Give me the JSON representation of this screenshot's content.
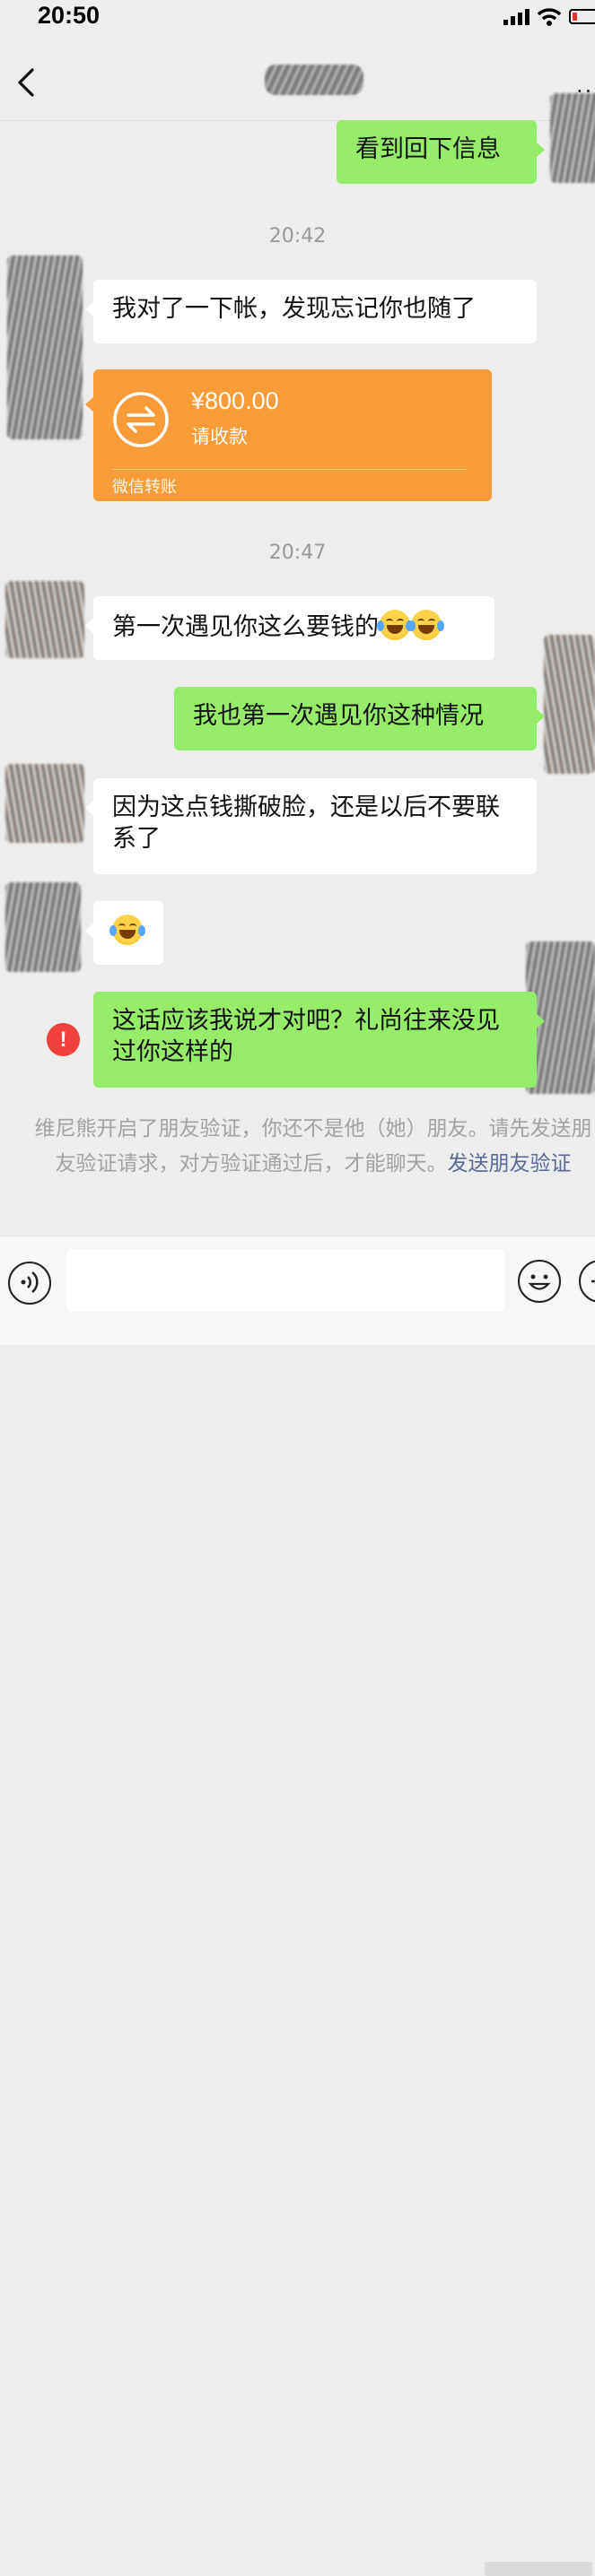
{
  "status_bar": {
    "time": "20:50"
  },
  "messages": {
    "m1": "看到回下信息",
    "t1": "20:42",
    "m2": "我对了一下帐，发现忘记你也随了",
    "transfer": {
      "amount": "¥800.00",
      "status": "请收款",
      "footer": "微信转账"
    },
    "t2": "20:47",
    "m3": "第一次遇见你这么要钱的",
    "m4": "我也第一次遇见你这种情况",
    "m5": "因为这点钱撕破脸，还是以后不要联系了",
    "m7": "这话应该我说才对吧？礼尚往来没见过你这样的"
  },
  "system_notice": {
    "text": "维尼熊开启了朋友验证，你还不是他（她）朋友。请先发送朋友验证请求，对方验证通过后，才能聊天。",
    "link": "发送朋友验证"
  },
  "colors": {
    "background": "#ededed",
    "outgoing_bubble": "#95ec69",
    "incoming_bubble": "#ffffff",
    "transfer_card": "#f79c38",
    "link": "#576b95",
    "error": "#f2413a"
  },
  "icons": [
    "back-chevron-icon",
    "more-icon",
    "transfer-arrows-icon",
    "grin-tears-emoji",
    "error-icon",
    "voice-icon",
    "emoji-icon",
    "plus-icon"
  ]
}
